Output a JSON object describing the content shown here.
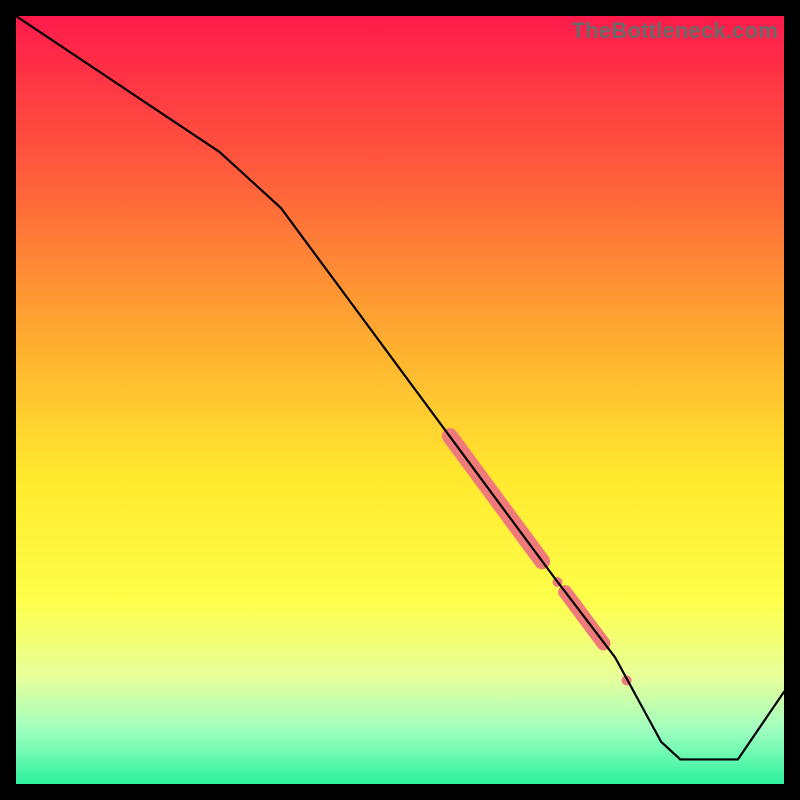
{
  "watermark": "TheBottleneck.com",
  "chart_data": {
    "type": "line",
    "title": "",
    "xlabel": "",
    "ylabel": "",
    "xlim": [
      0,
      100
    ],
    "ylim": [
      0,
      100
    ],
    "grid": false,
    "legend": false,
    "background_gradient": {
      "stops": [
        {
          "pos": 0.0,
          "color": "#ff1a4b"
        },
        {
          "pos": 0.2,
          "color": "#ff5a3c"
        },
        {
          "pos": 0.4,
          "color": "#ffa531"
        },
        {
          "pos": 0.6,
          "color": "#ffe92e"
        },
        {
          "pos": 0.76,
          "color": "#feff4a"
        },
        {
          "pos": 0.86,
          "color": "#e8ff9a"
        },
        {
          "pos": 0.93,
          "color": "#9fffc0"
        },
        {
          "pos": 1.0,
          "color": "#2cf19d"
        }
      ]
    },
    "series": [
      {
        "name": "curve",
        "color": "#000000",
        "width": 2.2,
        "x": [
          0.0,
          26.5,
          34.5,
          60.0,
          70.0,
          78.0,
          84.0,
          86.5,
          94.0,
          100.0
        ],
        "y": [
          100.0,
          82.3,
          75.0,
          40.5,
          27.0,
          16.5,
          5.5,
          3.2,
          3.2,
          12.0
        ]
      }
    ],
    "markers": [
      {
        "name": "highlight-segment-1",
        "shape": "capsule",
        "color": "#f07a7a",
        "endpoints": [
          [
            56.5,
            45.3
          ],
          [
            68.5,
            29.0
          ]
        ],
        "radius_px": 8
      },
      {
        "name": "highlight-dot-1",
        "shape": "circle",
        "color": "#f07a7a",
        "center": [
          70.5,
          26.3
        ],
        "radius_px": 5
      },
      {
        "name": "highlight-segment-2",
        "shape": "capsule",
        "color": "#f07a7a",
        "endpoints": [
          [
            71.5,
            25.0
          ],
          [
            76.5,
            18.3
          ]
        ],
        "radius_px": 7
      },
      {
        "name": "highlight-dot-2",
        "shape": "circle",
        "color": "#f07a7a",
        "center": [
          79.5,
          13.5
        ],
        "radius_px": 5
      }
    ]
  }
}
